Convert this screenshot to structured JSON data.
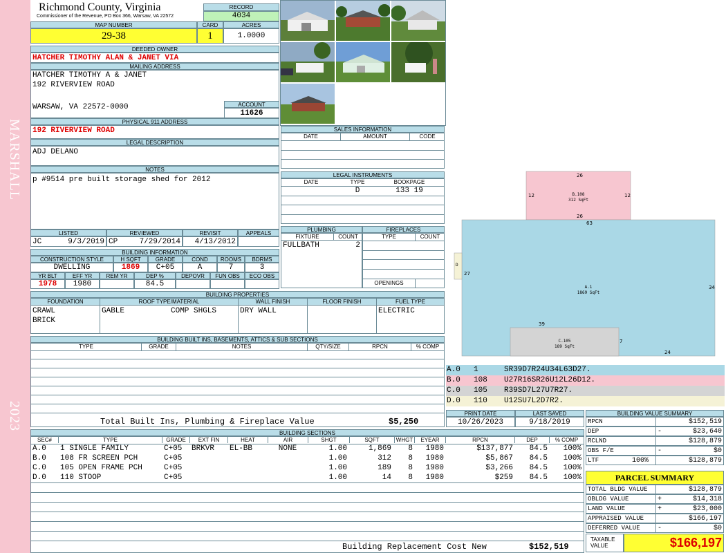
{
  "county": "Richmond County, Virginia",
  "commissioner": "Commissioner of the Revenue, PO Box 366, Warsaw, VA 22572",
  "record": {
    "label": "RECORD",
    "value": "4034"
  },
  "map_number": {
    "label": "MAP NUMBER",
    "value": "29-38"
  },
  "card": {
    "label": "CARD",
    "value": "1"
  },
  "acres": {
    "label": "ACRES",
    "value": "1.0000"
  },
  "deeded_owner": {
    "label": "DEEDED OWNER",
    "value": "HATCHER TIMOTHY ALAN & JANET VIA"
  },
  "mailing": {
    "label": "MAILING ADDRESS",
    "line1": "HATCHER TIMOTHY A & JANET",
    "line2": "192 RIVERVIEW ROAD",
    "line3": "WARSAW, VA 22572-0000"
  },
  "account": {
    "label": "ACCOUNT",
    "value": "11626"
  },
  "physical": {
    "label": "PHYSICAL 911 ADDRESS",
    "value": "192 RIVERVIEW ROAD"
  },
  "legal": {
    "label": "LEGAL DESCRIPTION",
    "value": "ADJ DELANO"
  },
  "notes": {
    "label": "NOTES",
    "value": "p #9514 pre built storage shed for 2012"
  },
  "review": {
    "listed_label": "LISTED",
    "reviewed_label": "REVIEWED",
    "revisit_label": "REVISIT",
    "appeals_label": "APPEALS",
    "listed_by": "JC",
    "listed_date": "9/3/2019",
    "reviewed_by": "CP",
    "reviewed_date": "7/29/2014",
    "revisit": "4/13/2012",
    "appeals": ""
  },
  "bldg_info": {
    "label": "BUILDING INFORMATION",
    "h1": [
      "CONSTRUCTION STYLE",
      "H SQFT",
      "GRADE",
      "COND",
      "ROOMS",
      "BDRMS"
    ],
    "v1": [
      "DWELLING",
      "1869",
      "C+05",
      "A",
      "7",
      "3"
    ],
    "h2": [
      "YR BLT",
      "EFF YR",
      "REM YR",
      "DEP %",
      "DEPOVR",
      "FUN OBS",
      "ECO OBS"
    ],
    "v2": [
      "1978",
      "1980",
      "",
      "84.5",
      "",
      "",
      ""
    ]
  },
  "sales": {
    "label": "SALES INFORMATION",
    "cols": [
      "DATE",
      "AMOUNT",
      "CODE"
    ]
  },
  "legal_instruments": {
    "label": "LEGAL INSTRUMENTS",
    "cols": [
      "DATE",
      "TYPE",
      "BOOKPAGE"
    ],
    "type": "D",
    "bookpage": "133 19"
  },
  "plumbing": {
    "label": "PLUMBING",
    "cols": [
      "FIXTURE",
      "COUNT"
    ],
    "fixture": "FULLBATH",
    "count": "2"
  },
  "fireplaces": {
    "label": "FIREPLACES",
    "cols": [
      "TYPE",
      "COUNT"
    ],
    "openings": "OPENINGS"
  },
  "bldg_props": {
    "label": "BUILDING PROPERTIES",
    "cols": [
      "FOUNDATION",
      "ROOF TYPE/MATERIAL",
      "WALL FINISH",
      "FLOOR FINISH",
      "FUEL TYPE"
    ],
    "foundation1": "CRAWL",
    "foundation2": "BRICK",
    "roof_type": "GABLE",
    "roof_mat": "COMP SHGLS",
    "wall": "DRY WALL",
    "floor": "",
    "fuel": "ELECTRIC"
  },
  "builtins": {
    "label": "BUILDING BUILT INS, BASEMENTS, ATTICS & SUB SECTIONS",
    "cols": [
      "TYPE",
      "GRADE",
      "NOTES",
      "QTY/SIZE",
      "RPCN",
      "% COMP"
    ],
    "total_label": "Total Built Ins, Plumbing & Fireplace Value",
    "total_value": "$5,250"
  },
  "print": {
    "print_label": "PRINT DATE",
    "print_date": "10/26/2023",
    "saved_label": "LAST SAVED",
    "saved_date": "9/18/2019"
  },
  "sections": {
    "label": "BUILDING SECTIONS",
    "cols": [
      "SEC#",
      "TYPE",
      "GRADE",
      "EXT FIN",
      "HEAT",
      "AIR",
      "SHGT",
      "SQFT",
      "WHGT",
      "EYEAR",
      "RPCN",
      "DEP",
      "% COMP"
    ],
    "rows": [
      [
        "A.0",
        "1 SINGLE FAMILY",
        "C+05",
        "BRKVR",
        "EL-BB",
        "NONE",
        "1.00",
        "1,869",
        "8",
        "1980",
        "$137,877",
        "84.5",
        "100%"
      ],
      [
        "B.0",
        "108 FR SCREEN PCH",
        "C+05",
        "",
        "",
        "",
        "1.00",
        "312",
        "8",
        "1980",
        "$5,867",
        "84.5",
        "100%"
      ],
      [
        "C.0",
        "105 OPEN FRAME PCH",
        "C+05",
        "",
        "",
        "",
        "1.00",
        "189",
        "8",
        "1980",
        "$3,266",
        "84.5",
        "100%"
      ],
      [
        "D.0",
        "110 STOOP",
        "C+05",
        "",
        "",
        "",
        "1.00",
        "14",
        "8",
        "1980",
        "$259",
        "84.5",
        "100%"
      ]
    ],
    "brcn_label": "Building Replacement Cost New",
    "brcn_value": "$152,519"
  },
  "sketch": {
    "b_label": "B.108",
    "b_sqft": "312 SqFt",
    "a_label": "A.1",
    "a_sqft": "1869 SqFt",
    "c_label": "C.105",
    "c_sqft": "189 SqFt",
    "d_label": "D",
    "dims": {
      "b_top": "26",
      "b_left": "12",
      "b_right": "12",
      "b_bottom": "26",
      "a_top": "63",
      "a_left": "27",
      "a_right": "34",
      "a_bottom": "24",
      "c_top": "39",
      "c_right": "7"
    },
    "legend": [
      {
        "code": "A.0",
        "num": "1",
        "path": "SR39D7R24U34L63D27.",
        "color": "#aad8e6"
      },
      {
        "code": "B.0",
        "num": "108",
        "path": "U27R16SR26U12L26D12.",
        "color": "#f7c6d0"
      },
      {
        "code": "C.0",
        "num": "105",
        "path": "R39SD7L27U7R27.",
        "color": "#d4d4d4"
      },
      {
        "code": "D.0",
        "num": "110",
        "path": "U12SU7L2D7R2.",
        "color": "#f5f2d6"
      }
    ]
  },
  "value_summary": {
    "label": "BUILDING VALUE SUMMARY",
    "rpcn_l": "RPCN",
    "rpcn_v": "$152,519",
    "dep_l": "DEP",
    "dep_s": "-",
    "dep_v": "$23,640",
    "rclnd_l": "RCLND",
    "rclnd_v": "$128,879",
    "obs_l": "OBS F/E",
    "obs_s": "-",
    "obs_v": "$0",
    "ltf_l": "LTF",
    "ltf_p": "100%",
    "ltf_v": "$128,879"
  },
  "parcel": {
    "label": "PARCEL SUMMARY",
    "total_l": "TOTAL BLDG VALUE",
    "total_v": "$128,879",
    "obldg_l": "OBLDG VALUE",
    "obldg_s": "+",
    "obldg_v": "$14,318",
    "land_l": "LAND VALUE",
    "land_s": "+",
    "land_v": "$23,000",
    "appr_l": "APPRAISED VALUE",
    "appr_v": "$166,197",
    "def_l": "DEFERRED VALUE",
    "def_s": "-",
    "def_v": "$0",
    "taxable_l1": "TAXABLE",
    "taxable_l2": "VALUE",
    "taxable_v": "$166,197"
  },
  "side": {
    "district": "MARSHALL",
    "year": "2023"
  },
  "colors": {
    "yellow": "#ffff33",
    "green": "#bff2b8",
    "header": "#b9dde8",
    "pink_sidebar": "#f7c6d0",
    "red": "#d00000"
  }
}
